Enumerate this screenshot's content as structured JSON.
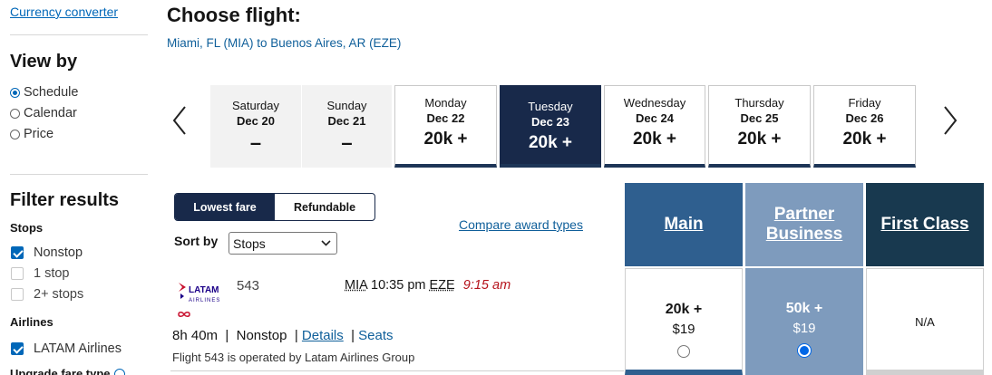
{
  "sidebar": {
    "currency_link": "Currency converter",
    "view_by_title": "View by",
    "view_options": [
      {
        "label": "Schedule",
        "selected": true
      },
      {
        "label": "Calendar",
        "selected": false
      },
      {
        "label": "Price",
        "selected": false
      }
    ],
    "filter_title": "Filter results",
    "stops_title": "Stops",
    "stops": [
      {
        "label": "Nonstop",
        "checked": true
      },
      {
        "label": "1 stop",
        "checked": false
      },
      {
        "label": "2+ stops",
        "checked": false
      }
    ],
    "airlines_title": "Airlines",
    "airlines": [
      {
        "label": "LATAM Airlines",
        "checked": true
      }
    ],
    "upgrade_title": "Upgrade fare type"
  },
  "header": {
    "title": "Choose flight:",
    "route": "Miami, FL (MIA) to Buenos Aires, AR (EZE)"
  },
  "dates": [
    {
      "dow": "Saturday",
      "date": "Dec 20",
      "price": "–",
      "state": "unavailable"
    },
    {
      "dow": "Sunday",
      "date": "Dec 21",
      "price": "–",
      "state": "unavailable"
    },
    {
      "dow": "Monday",
      "date": "Dec 22",
      "price": "20k +",
      "state": "available"
    },
    {
      "dow": "Tuesday",
      "date": "Dec 23",
      "price": "20k +",
      "state": "selected"
    },
    {
      "dow": "Wednesday",
      "date": "Dec 24",
      "price": "20k +",
      "state": "available"
    },
    {
      "dow": "Thursday",
      "date": "Dec 25",
      "price": "20k +",
      "state": "available"
    },
    {
      "dow": "Friday",
      "date": "Dec 26",
      "price": "20k +",
      "state": "available"
    }
  ],
  "controls": {
    "fare_options": [
      "Lowest fare",
      "Refundable"
    ],
    "active_fare_option": "Lowest fare",
    "sort_label": "Sort by",
    "sort_value": "Stops",
    "compare_link": "Compare award types"
  },
  "cabins": [
    {
      "label": "Main",
      "color": "#2f5f8f"
    },
    {
      "label": "Partner Business",
      "color": "#7e9bbd"
    },
    {
      "label": "First Class",
      "color": "#18394f"
    }
  ],
  "flight": {
    "airline_logo_text": "LATAM",
    "airline_logo_sub": "AIRLINES",
    "number": "543",
    "origin": "MIA",
    "depart_time": "10:35 pm",
    "destination": "EZE",
    "arrive_time": "9:15 am",
    "duration": "8h 40m",
    "stops": "Nonstop",
    "details_link": "Details",
    "seats_link": "Seats",
    "operated_by": "Flight 543 is operated by Latam Airlines Group",
    "fares": [
      {
        "points": "20k +",
        "fee": "$19",
        "selected": false
      },
      {
        "points": "50k +",
        "fee": "$19",
        "selected": true
      },
      {
        "points": "N/A",
        "fee": "",
        "selected": false
      }
    ]
  },
  "colors": {
    "link_blue": "#0067b8",
    "navy": "#18294a",
    "main_cabin": "#2f5f8f",
    "partner_business": "#7e9bbd",
    "first_class": "#18394f",
    "arrival_red": "#b5121b"
  }
}
